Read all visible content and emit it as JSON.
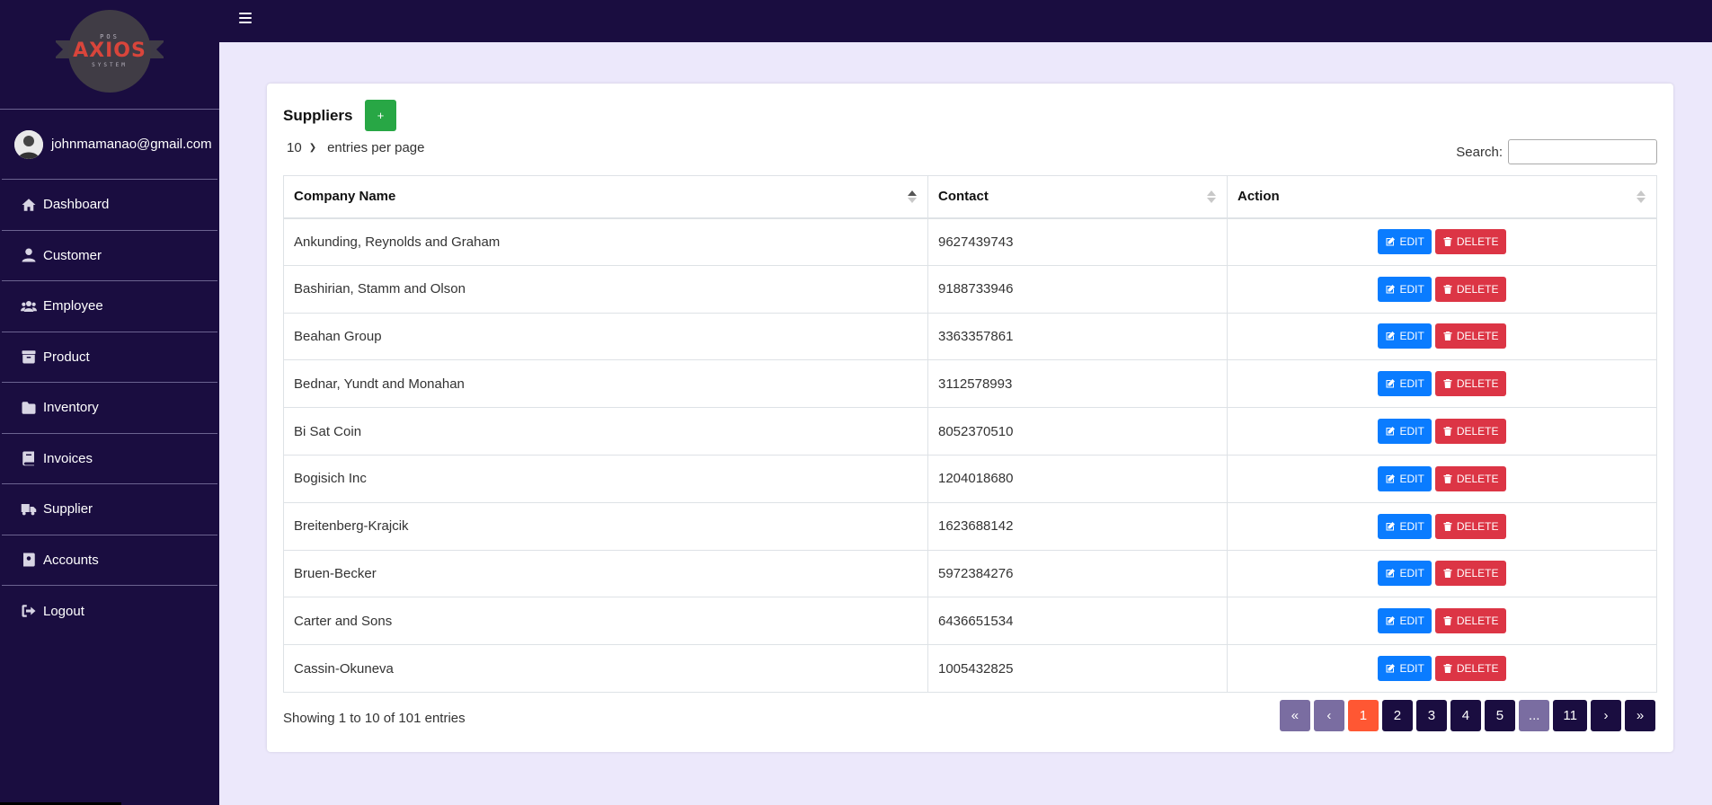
{
  "app": {
    "logo": {
      "top": "POS",
      "brand": "AXIOS",
      "bottom": "SYSTEM"
    },
    "user_email": "johnmamanao@gmail.com"
  },
  "sidebar": {
    "items": [
      {
        "label": "Dashboard",
        "icon": "home-icon"
      },
      {
        "label": "Customer",
        "icon": "user-icon"
      },
      {
        "label": "Employee",
        "icon": "users-icon"
      },
      {
        "label": "Product",
        "icon": "archive-icon"
      },
      {
        "label": "Inventory",
        "icon": "folder-icon"
      },
      {
        "label": "Invoices",
        "icon": "book-icon"
      },
      {
        "label": "Supplier",
        "icon": "truck-icon"
      },
      {
        "label": "Accounts",
        "icon": "address-book-icon"
      },
      {
        "label": "Logout",
        "icon": "sign-out-icon"
      }
    ]
  },
  "page": {
    "title": "Suppliers",
    "add_label": "+",
    "length_value": "10",
    "length_suffix": "entries per page",
    "search_label": "Search:",
    "search_value": ""
  },
  "table": {
    "headers": {
      "company": "Company Name",
      "contact": "Contact",
      "action": "Action"
    },
    "edit_label": "EDIT",
    "delete_label": "DELETE",
    "rows": [
      {
        "company": "Ankunding, Reynolds and Graham",
        "contact": "9627439743"
      },
      {
        "company": "Bashirian, Stamm and Olson",
        "contact": "9188733946"
      },
      {
        "company": "Beahan Group",
        "contact": "3363357861"
      },
      {
        "company": "Bednar, Yundt and Monahan",
        "contact": "3112578993"
      },
      {
        "company": "Bi Sat Coin",
        "contact": "8052370510"
      },
      {
        "company": "Bogisich Inc",
        "contact": "1204018680"
      },
      {
        "company": "Breitenberg-Krajcik",
        "contact": "1623688142"
      },
      {
        "company": "Bruen-Becker",
        "contact": "5972384276"
      },
      {
        "company": "Carter and Sons",
        "contact": "6436651534"
      },
      {
        "company": "Cassin-Okuneva",
        "contact": "1005432825"
      }
    ]
  },
  "footer": {
    "info": "Showing 1 to 10 of 101 entries",
    "pager": [
      {
        "label": "«",
        "state": "disabled"
      },
      {
        "label": "‹",
        "state": "disabled"
      },
      {
        "label": "1",
        "state": "current"
      },
      {
        "label": "2",
        "state": "normal"
      },
      {
        "label": "3",
        "state": "normal"
      },
      {
        "label": "4",
        "state": "normal"
      },
      {
        "label": "5",
        "state": "normal"
      },
      {
        "label": "...",
        "state": "ellipsis"
      },
      {
        "label": "11",
        "state": "normal"
      },
      {
        "label": "›",
        "state": "normal"
      },
      {
        "label": "»",
        "state": "normal"
      }
    ]
  },
  "colors": {
    "sidebar": "#1a0d40",
    "page_bg": "#ece8fb",
    "add": "#28a745",
    "edit": "#0a7cff",
    "delete": "#dc3545",
    "current_page": "#ff5733"
  }
}
